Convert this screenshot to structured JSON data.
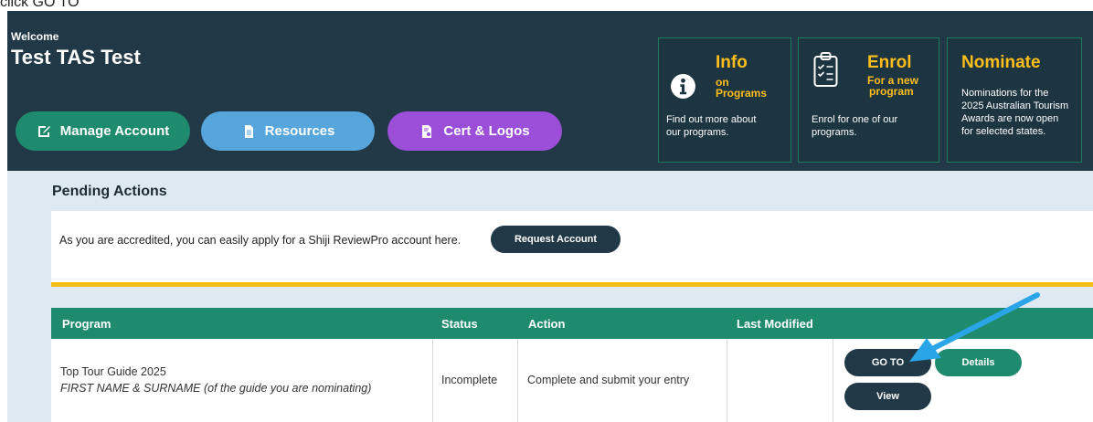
{
  "caption": "click GO TO",
  "header": {
    "welcome": "Welcome",
    "user_name": "Test TAS Test",
    "buttons": {
      "manage": "Manage Account",
      "resources": "Resources",
      "cert": "Cert & Logos"
    }
  },
  "cards": {
    "info": {
      "title": "Info",
      "subtitle": [
        "on",
        "Programs"
      ],
      "body": [
        "Find out more about",
        "our programs."
      ],
      "icon": "info-circle-icon"
    },
    "enrol": {
      "title": "Enrol",
      "subtitle": [
        "For a new",
        "program"
      ],
      "body": [
        "Enrol for one of our",
        "programs."
      ],
      "icon": "clipboard-checklist-icon"
    },
    "nominate": {
      "title": "Nominate",
      "body": [
        "Nominations for the",
        "2025 Australian Tourism",
        "Awards are now open",
        "for selected states."
      ]
    }
  },
  "pending": {
    "title": "Pending Actions",
    "notice": "As you are accredited, you can easily apply for a Shiji ReviewPro account here.",
    "request_button": "Request Account"
  },
  "table": {
    "headers": [
      "Program",
      "Status",
      "Action",
      "Last Modified"
    ],
    "rows": [
      {
        "program": "Top Tour Guide 2025",
        "program_note": "FIRST NAME & SURNAME (of the guide you are nominating)",
        "status": "Incomplete",
        "action": "Complete and submit your entry",
        "last_modified": "",
        "buttons": {
          "goto": "GO TO",
          "details": "Details",
          "view": "View"
        }
      }
    ]
  },
  "colors": {
    "header_bg": "#213847",
    "accent_green": "#1e8a6e",
    "accent_blue": "#56a6dc",
    "accent_purple": "#9b4fd8",
    "card_title": "#ffbe1a",
    "divider_yellow": "#f6bd16",
    "arrow": "#2aa6e8"
  }
}
